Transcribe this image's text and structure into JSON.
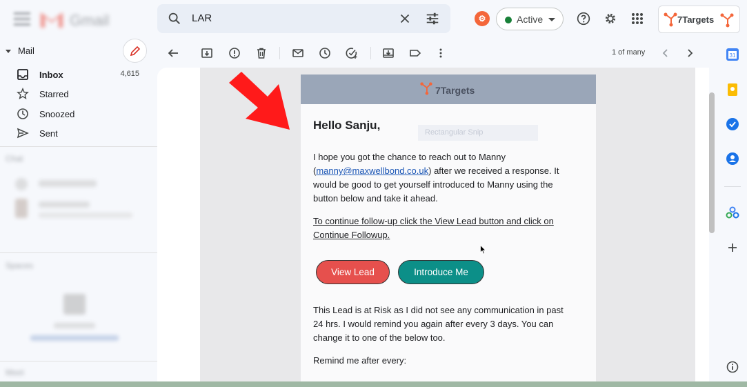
{
  "app": {
    "name": "Gmail",
    "account_status": "Active",
    "extension_name": "7Targets"
  },
  "search": {
    "query": "LAR"
  },
  "sidebar": {
    "section_title": "Mail",
    "items": [
      {
        "label": "Inbox",
        "count": "4,615",
        "icon": "inbox-icon"
      },
      {
        "label": "Starred",
        "count": "",
        "icon": "star-icon"
      },
      {
        "label": "Snoozed",
        "count": "",
        "icon": "clock-icon"
      },
      {
        "label": "Sent",
        "count": "",
        "icon": "send-icon"
      }
    ],
    "blurred_sections": [
      "Chat",
      "Spaces",
      "Meet"
    ]
  },
  "toolbar": {
    "pager_text": "1 of many",
    "icons": [
      "back-icon",
      "archive-icon",
      "report-spam-icon",
      "delete-icon",
      "mark-unread-icon",
      "snooze-icon",
      "add-task-icon",
      "move-to-icon",
      "labels-icon",
      "more-icon"
    ]
  },
  "email": {
    "header_brand": "7Targets",
    "overlay_text": "Rectangular Snip",
    "greeting": "Hello Sanju,",
    "para1_before": "I hope you got the chance to reach out to Manny (",
    "para1_link": "manny@maxwellbond.co.uk",
    "para1_after": ") after we received a response. It would be good to get yourself introduced to Manny using the button below and take it ahead.",
    "instruction": "To continue follow-up click the View Lead button and click on Continue Followup.",
    "view_lead_label": "View Lead",
    "introduce_label": "Introduce Me",
    "risk_text": "This Lead is at Risk as I did not see any communication in past 24 hrs. I would remind you again after every 3 days. You can change it to one of the below too.",
    "remind_label": "Remind me after every:"
  },
  "colors": {
    "view_lead": "#e6504d",
    "introduce_me": "#0c8f88",
    "status_green": "#188038",
    "annotation_arrow": "#ff1a1a"
  }
}
